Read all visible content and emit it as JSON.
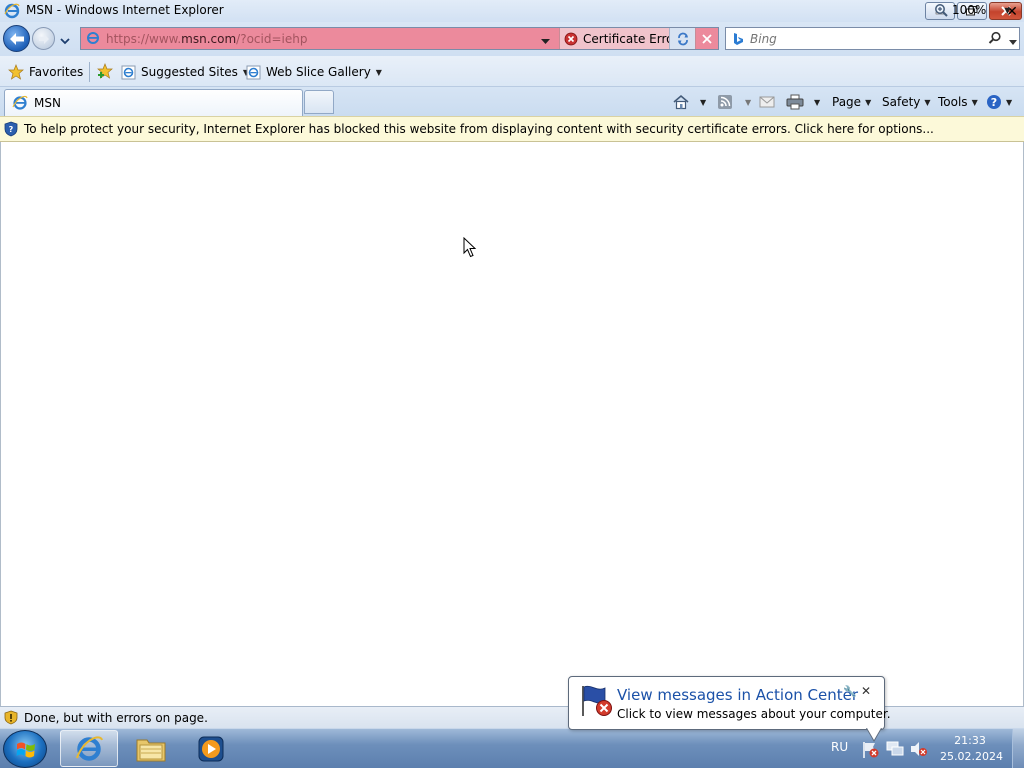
{
  "window": {
    "title": "MSN - Windows Internet Explorer",
    "minimize_glyph": "–",
    "maximize_glyph": "❐",
    "close_glyph": "✕"
  },
  "navigation": {
    "back_icon": "back-arrow-icon",
    "forward_icon": "forward-arrow-icon"
  },
  "address_bar": {
    "url_prefix": "https://www.",
    "url_domain": "msn.com",
    "url_suffix": "/?ocid=iehp",
    "certificate_error_label": "Certificate Error",
    "error_color": "#ec8a9c"
  },
  "search": {
    "placeholder": "Bing",
    "provider_icon": "bing-icon"
  },
  "favorites_bar": {
    "favorites_label": "Favorites",
    "suggested_sites_label": "Suggested Sites",
    "web_slice_gallery_label": "Web Slice Gallery"
  },
  "tabs": [
    {
      "label": "MSN",
      "active": true
    }
  ],
  "command_bar": {
    "page_label": "Page",
    "safety_label": "Safety",
    "tools_label": "Tools"
  },
  "info_bar": {
    "message": "To help protect your security, Internet Explorer has blocked this website from displaying content with security certificate errors. Click here for options...",
    "close_glyph": "✕"
  },
  "status_bar": {
    "message": "Done, but with errors on page.",
    "zoom": "100%"
  },
  "taskbar": {
    "pinned": [
      "internet-explorer",
      "windows-explorer",
      "windows-media-player"
    ],
    "language": "RU",
    "time": "21:33",
    "date": "25.02.2024"
  },
  "notification": {
    "title": "View messages in Action Center",
    "text": "Click to view messages about your computer.",
    "close_glyph": "✕"
  }
}
